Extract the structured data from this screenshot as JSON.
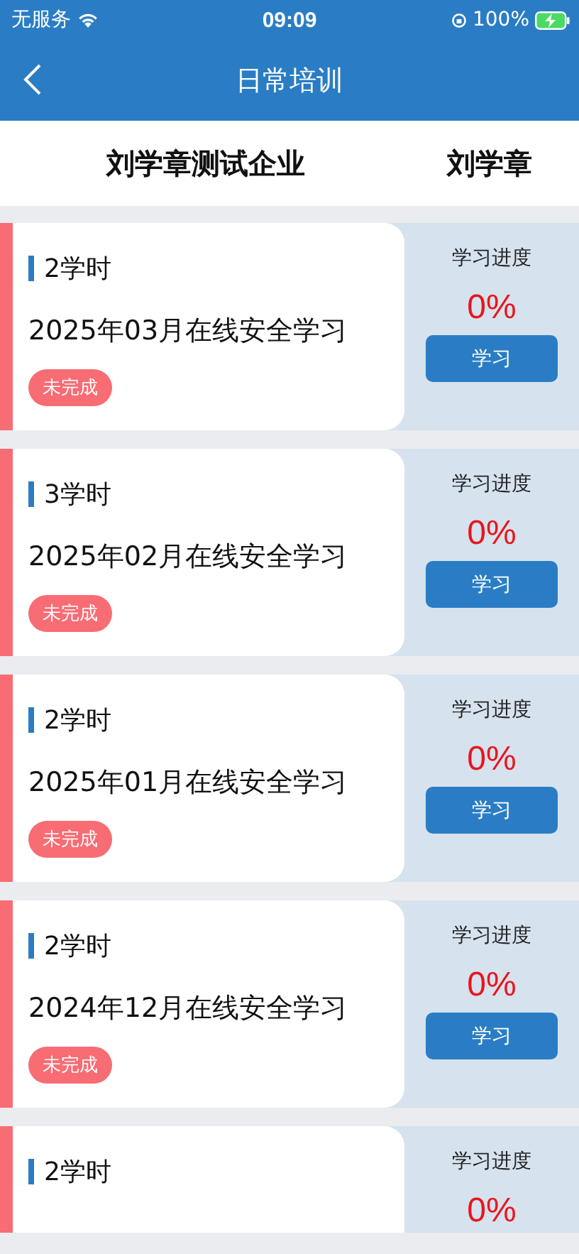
{
  "status_bar": {
    "carrier": "无服务",
    "time": "09:09",
    "battery": "100%"
  },
  "nav": {
    "title": "日常培训"
  },
  "header": {
    "company": "刘学章测试企业",
    "user": "刘学章"
  },
  "courses": [
    {
      "hours": "2学时",
      "title": "2025年03月在线安全学习",
      "status": "未完成",
      "completed": false,
      "progress_label": "学习进度",
      "progress": "0%",
      "action": "学习"
    },
    {
      "hours": "3学时",
      "title": "2025年02月在线安全学习",
      "status": "未完成",
      "completed": false,
      "progress_label": "学习进度",
      "progress": "0%",
      "action": "学习"
    },
    {
      "hours": "2学时",
      "title": "2025年01月在线安全学习",
      "status": "未完成",
      "completed": false,
      "progress_label": "学习进度",
      "progress": "0%",
      "action": "学习"
    },
    {
      "hours": "2学时",
      "title": "2024年12月在线安全学习",
      "status": "未完成",
      "completed": false,
      "progress_label": "学习进度",
      "progress": "0%",
      "action": "学习"
    },
    {
      "hours": "2学时",
      "progress_label": "学习进度",
      "progress": "0%"
    }
  ]
}
